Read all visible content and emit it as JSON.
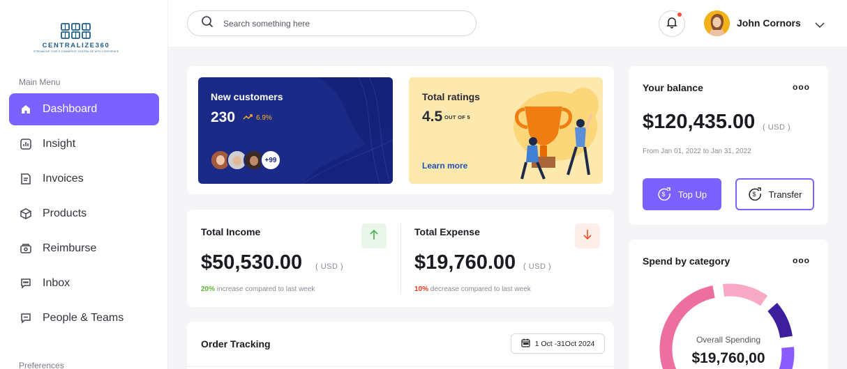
{
  "brand": {
    "name": "CENTRALIZE360",
    "tagline": "STREAMLINE YOUR E-COMMERCE: CENTRALIZE WITH CONFIDENCE"
  },
  "sidebar": {
    "section_main": "Main Menu",
    "section_prefs": "Preferences",
    "items": [
      {
        "label": "Dashboard",
        "icon": "home-icon",
        "active": true
      },
      {
        "label": "Insight",
        "icon": "insight-icon",
        "active": false
      },
      {
        "label": "Invoices",
        "icon": "invoice-icon",
        "active": false
      },
      {
        "label": "Products",
        "icon": "box-icon",
        "active": false
      },
      {
        "label": "Reimburse",
        "icon": "reimburse-icon",
        "active": false
      },
      {
        "label": "Inbox",
        "icon": "chat-icon",
        "active": false
      },
      {
        "label": "People & Teams",
        "icon": "people-icon",
        "active": false
      }
    ]
  },
  "topbar": {
    "search_placeholder": "Search something here",
    "user_name": "John Cornors"
  },
  "customers": {
    "title": "New customers",
    "value": "230",
    "trend": "6.9%",
    "more": "+99"
  },
  "ratings": {
    "title": "Total ratings",
    "value": "4.5",
    "unit": "OUT OF 5",
    "link": "Learn more"
  },
  "income": {
    "title": "Total Income",
    "value": "$50,530.00",
    "unit": "( USD )",
    "pct": "20%",
    "note": " increase compared to last week"
  },
  "expense": {
    "title": "Total Expense",
    "value": "$19,760.00",
    "unit": "( USD )",
    "pct": "10%",
    "note": " decrease compared to last week"
  },
  "order": {
    "title": "Order Tracking",
    "date_range": "1 Oct -31Oct 2024"
  },
  "balance": {
    "title": "Your balance",
    "value": "$120,435.00",
    "unit": "( USD )",
    "range": "From Jan 01, 2022 to Jan 31, 2022",
    "topup": "Top Up",
    "transfer": "Transfer",
    "more": "ooo"
  },
  "spend": {
    "title": "Spend by category",
    "label": "Overall Spending",
    "value": "$19,760,00",
    "more": "ooo"
  },
  "colors": {
    "accent": "#7b61ff",
    "navy": "#1b2a86",
    "yellow": "#fde9ad",
    "up": "#4caf50",
    "down": "#f04e23"
  }
}
